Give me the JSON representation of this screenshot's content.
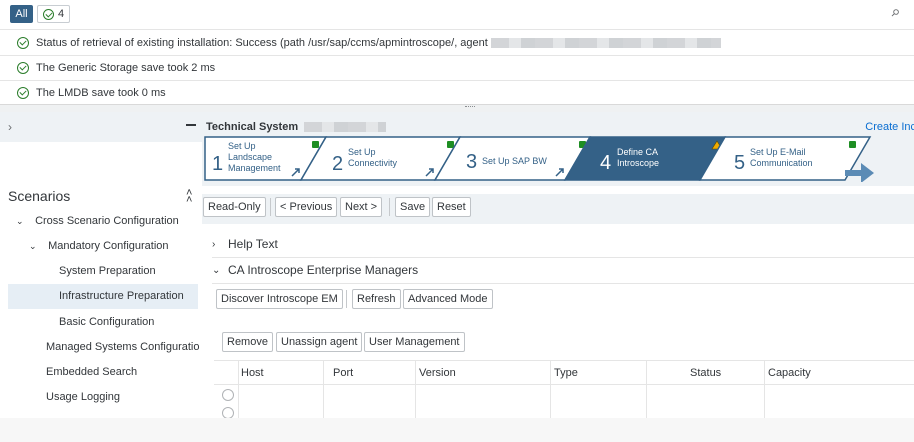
{
  "messages": {
    "filter": {
      "all_label": "All",
      "success_count": "4"
    },
    "items": [
      {
        "text": "Status of retrieval of existing installation: Success (path /usr/sap/ccms/apmintroscope/, agent"
      },
      {
        "text": "The Generic Storage save took 2 ms"
      },
      {
        "text": "The LMDB save took 0 ms"
      }
    ]
  },
  "sidebar": {
    "title": "Scenarios",
    "tree": [
      {
        "label": "Cross Scenario Configuration",
        "level": 1,
        "expanded": true
      },
      {
        "label": "Mandatory Configuration",
        "level": 2,
        "expanded": true
      },
      {
        "label": "System Preparation",
        "level": 3
      },
      {
        "label": "Infrastructure Preparation",
        "level": 3,
        "selected": true
      },
      {
        "label": "Basic Configuration",
        "level": 3
      },
      {
        "label": "Managed Systems Configuratio",
        "level": 2
      },
      {
        "label": "Embedded Search",
        "level": 2
      },
      {
        "label": "Usage Logging",
        "level": 2
      }
    ]
  },
  "header": {
    "title": "Technical System",
    "create_link": "Create Inc"
  },
  "roadmap": {
    "steps": [
      {
        "num": "1",
        "label_lines": [
          "Set Up",
          "Landscape",
          "Management"
        ],
        "status": "ok"
      },
      {
        "num": "2",
        "label_lines": [
          "Set Up",
          "Connectivity"
        ],
        "status": "ok"
      },
      {
        "num": "3",
        "label_lines": [
          "Set Up SAP BW"
        ],
        "status": "ok"
      },
      {
        "num": "4",
        "label_lines": [
          "Define CA",
          "Introscope"
        ],
        "status": "warning",
        "active": true
      },
      {
        "num": "5",
        "label_lines": [
          "Set Up E-Mail",
          "Communication"
        ],
        "status": "ok"
      }
    ]
  },
  "toolbar": {
    "readonly": "Read-Only",
    "previous": "< Previous",
    "next": "Next >",
    "save": "Save",
    "reset": "Reset"
  },
  "panels": {
    "help_text": "Help Text",
    "em_title": "CA Introscope Enterprise Managers"
  },
  "em_toolbar": {
    "discover": "Discover Introscope EM",
    "refresh": "Refresh",
    "advanced": "Advanced Mode"
  },
  "agent_toolbar": {
    "remove": "Remove",
    "unassign": "Unassign agent",
    "user_mgmt": "User Management"
  },
  "table": {
    "columns": [
      "Host",
      "Port",
      "Version",
      "Type",
      "Status",
      "Capacity"
    ]
  },
  "colors": {
    "active_step": "#346187",
    "ok_indicator": "#1e8e23",
    "warning_indicator": "#f0ab00",
    "link": "#0a6ed1",
    "success": "#2b7d2b"
  }
}
